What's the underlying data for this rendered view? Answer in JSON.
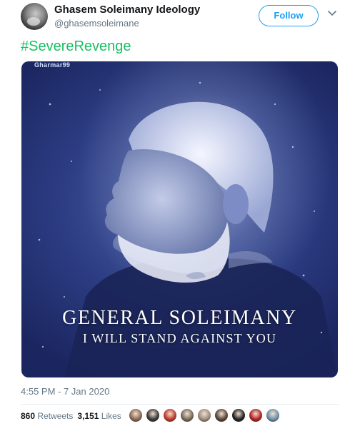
{
  "author": {
    "display_name": "Ghasem Soleimany Ideology",
    "handle": "@ghasemsoleimane",
    "avatar_icon": "profile-photo"
  },
  "follow_label": "Follow",
  "menu_icon": "chevron-down-icon",
  "hashtag": "#SevereRevenge",
  "media": {
    "logo_text": "Gharmar99",
    "headline": "General Soleimany",
    "subline": "I Will Stand Against You",
    "colors": {
      "primary": "#2c3c82",
      "dark": "#1b2660",
      "light": "#e6ebfa"
    }
  },
  "timestamp": "4:55 PM - 7 Jan 2020",
  "stats": {
    "retweets_count": "860",
    "retweets_label": "Retweets",
    "likes_count": "3,151",
    "likes_label": "Likes"
  },
  "likers": [
    {
      "name": "liker-avatar-1",
      "color": "#8c6a55"
    },
    {
      "name": "liker-avatar-2",
      "color": "#3a3a3a"
    },
    {
      "name": "liker-avatar-3",
      "color": "#c0392b"
    },
    {
      "name": "liker-avatar-4",
      "color": "#7a6b5a"
    },
    {
      "name": "liker-avatar-5",
      "color": "#a08c7c"
    },
    {
      "name": "liker-avatar-6",
      "color": "#5b4636"
    },
    {
      "name": "liker-avatar-7",
      "color": "#222222"
    },
    {
      "name": "liker-avatar-8",
      "color": "#b22222"
    },
    {
      "name": "liker-avatar-9",
      "color": "#6f8fa8"
    }
  ],
  "accent_color": "#1da1f2",
  "hashtag_color": "#17bf63"
}
